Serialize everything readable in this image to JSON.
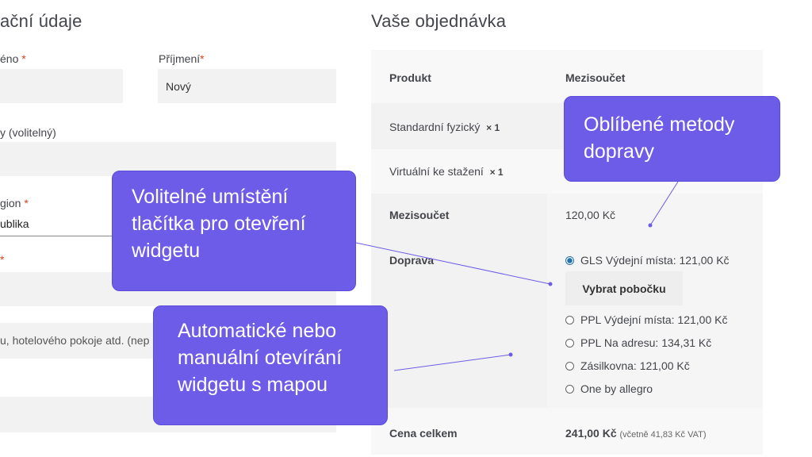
{
  "billing": {
    "section_title": "ační údaje",
    "first_name_label": "éno",
    "last_name_label": "Příjmení",
    "last_name_value": "Nový",
    "company_label": "y (volitelný)",
    "region_label": "gion",
    "region_value": "ublika",
    "street_label": "",
    "apartment_placeholder": "u, hotelového pokoje atd. (nep",
    "required_mark": "*"
  },
  "order": {
    "section_title": "Vaše objednávka",
    "col_product": "Produkt",
    "col_subtotal": "Mezisoučet",
    "items": [
      {
        "name": "Standardní fyzický",
        "qty": "× 1"
      },
      {
        "name": "Virtuální ke stažení",
        "qty": "× 1"
      }
    ],
    "subtotal_label": "Mezisoučet",
    "subtotal_value": "120,00 Kč",
    "shipping_label": "Doprava",
    "shipping_options": [
      {
        "label": "GLS Výdejní místa: 121,00 Kč",
        "selected": true
      },
      {
        "label": "PPL Výdejní místa: 121,00 Kč",
        "selected": false
      },
      {
        "label": "PPL Na adresu: 134,31 Kč",
        "selected": false
      },
      {
        "label": "Zásilkovna: 121,00 Kč",
        "selected": false
      },
      {
        "label": "One by allegro",
        "selected": false
      }
    ],
    "pickup_button": "Vybrat pobočku",
    "total_label": "Cena celkem",
    "total_value": "241,00 Kč",
    "total_tax_note": "(včetně 41,83 Kč VAT)"
  },
  "callouts": {
    "favorite_methods": "Oblíbené metody dopravy",
    "button_placement": "Volitelné umístění tlačítka pro otevření widgetu",
    "auto_open": "Automatické nebo manuální otevírání widgetu s mapou"
  },
  "colors": {
    "callout_bg": "#6c5ce7",
    "radio_accent": "#2271b1",
    "required": "#e2401c"
  }
}
